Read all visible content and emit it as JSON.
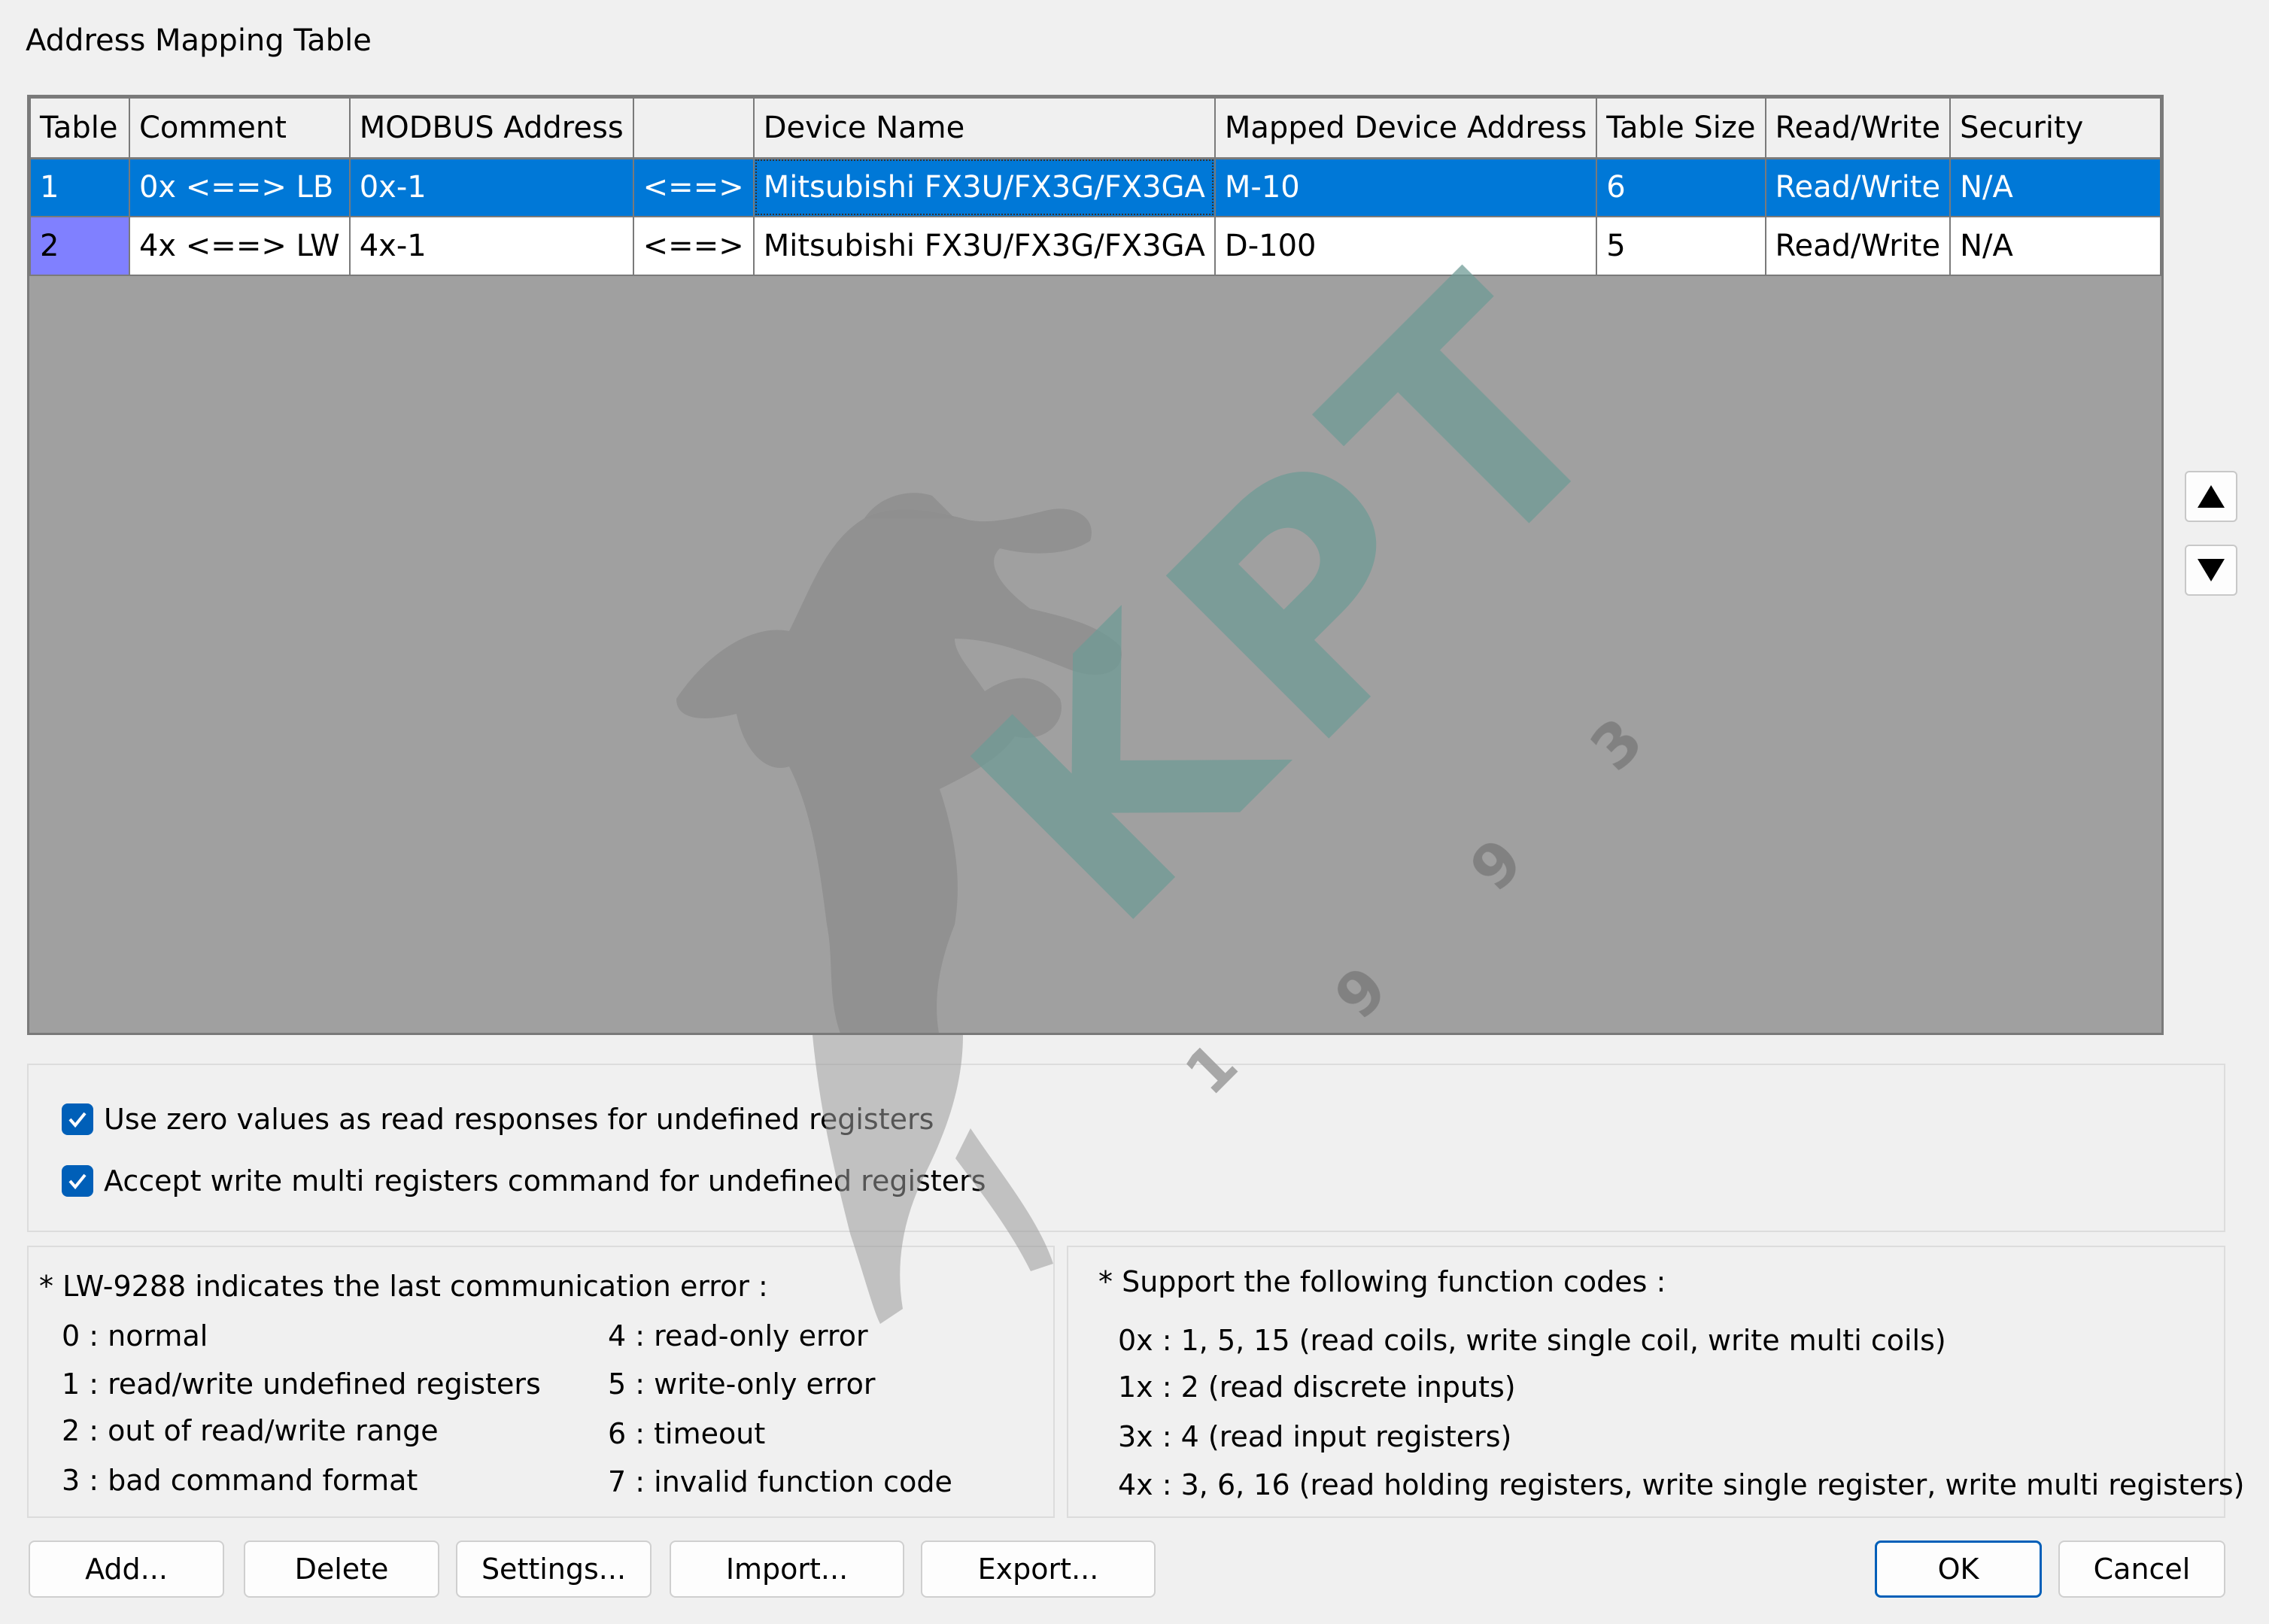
{
  "window": {
    "title": "Address Mapping Table"
  },
  "table": {
    "columns": [
      "Table",
      "Comment",
      "MODBUS Address",
      "",
      "Device Name",
      "Mapped Device Address",
      "Table Size",
      "Read/Write",
      "Security"
    ],
    "rows": [
      [
        "1",
        "0x <==> LB",
        "0x-1",
        "<==>",
        "Mitsubishi FX3U/FX3G/FX3GA",
        "M-10",
        "6",
        "Read/Write",
        "N/A"
      ],
      [
        "2",
        "4x <==> LW",
        "4x-1",
        "<==>",
        "Mitsubishi FX3U/FX3G/FX3GA",
        "D-100",
        "5",
        "Read/Write",
        "N/A"
      ]
    ],
    "selected_row": 1
  },
  "watermark": {
    "letters": [
      "K",
      "P",
      "T"
    ],
    "digits": [
      "1",
      "9",
      "9",
      "3"
    ]
  },
  "options": {
    "zero_values": {
      "label": "Use zero values as read responses for undefined registers",
      "checked": true
    },
    "accept_write": {
      "label": "Accept write multi registers command for undefined registers",
      "checked": true
    }
  },
  "errors": {
    "title": "* LW-9288 indicates the last communication error :",
    "left": [
      "0 : normal",
      "1 : read/write undefined registers",
      "2 : out of read/write range",
      "3 : bad command format"
    ],
    "right": [
      "4 : read-only error",
      "5 : write-only error",
      "6 : timeout",
      "7 : invalid function code"
    ]
  },
  "function_codes": {
    "title": "* Support the following function codes :",
    "items": [
      "0x : 1, 5, 15 (read coils, write single coil, write multi coils)",
      "1x : 2 (read discrete inputs)",
      "3x : 4 (read input registers)",
      "4x : 3, 6, 16 (read holding registers, write single register, write multi registers)"
    ]
  },
  "buttons": {
    "add": "Add...",
    "delete": "Delete",
    "settings": "Settings...",
    "import": "Import...",
    "export": "Export...",
    "ok": "OK",
    "cancel": "Cancel"
  },
  "colors": {
    "selection": "#0078d7",
    "row_header_highlight": "#8080ff",
    "grid_background": "#a0a0a0",
    "checkbox": "#005fb8",
    "watermark_text": "#6f9b96"
  },
  "icons": {
    "move_up": "triangle-up-icon",
    "move_down": "triangle-down-icon",
    "check": "checkmark-icon"
  }
}
